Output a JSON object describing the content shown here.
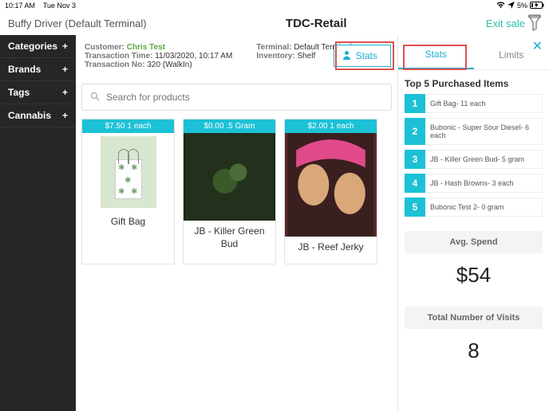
{
  "statusbar": {
    "time": "10:17 AM",
    "date": "Tue Nov 3",
    "battery": "5%"
  },
  "header": {
    "terminal_user": "Buffy Driver (Default Terminal)",
    "app_title": "TDC-Retail",
    "exit_label": "Exit sale"
  },
  "sidebar": {
    "items": [
      {
        "label": "Categories"
      },
      {
        "label": "Brands"
      },
      {
        "label": "Tags"
      },
      {
        "label": "Cannabis"
      }
    ],
    "plus": "+"
  },
  "tx": {
    "customer_label": "Customer:",
    "customer_name": "Chris Test",
    "time_label": "Transaction Time:",
    "time_value": "11/03/2020, 10:17 AM",
    "txno_label": "Transaction No:",
    "txno_value": "320 (WalkIn)",
    "terminal_label": "Terminal:",
    "terminal_value": "Default Terminal",
    "inventory_label": "Inventory:",
    "inventory_value": "Shelf",
    "stats_button": "Stats"
  },
  "search": {
    "placeholder": "Search for products"
  },
  "products": [
    {
      "price": "$7.50 1 each",
      "title": "Gift Bag"
    },
    {
      "price": "$0.00 .5 Gram",
      "title": "JB - Killer Green Bud"
    },
    {
      "price": "$2.00 1 each",
      "title": "JB - Reef Jerky"
    }
  ],
  "panel": {
    "tabs": {
      "stats": "Stats",
      "limits": "Limits"
    },
    "top5_title": "Top 5 Purchased Items",
    "top5": [
      {
        "rank": "1",
        "label": "Gift Bag- 11 each"
      },
      {
        "rank": "2",
        "label": "Bubonic - Super Sour Diesel- 6 each"
      },
      {
        "rank": "3",
        "label": "JB - Killer Green Bud- 5 gram"
      },
      {
        "rank": "4",
        "label": "JB - Hash Browns- 3 each"
      },
      {
        "rank": "5",
        "label": "Bubonic Test 2- 0 gram"
      }
    ],
    "avg_label": "Avg. Spend",
    "avg_value": "$54",
    "visits_label": "Total Number of Visits",
    "visits_value": "8"
  }
}
